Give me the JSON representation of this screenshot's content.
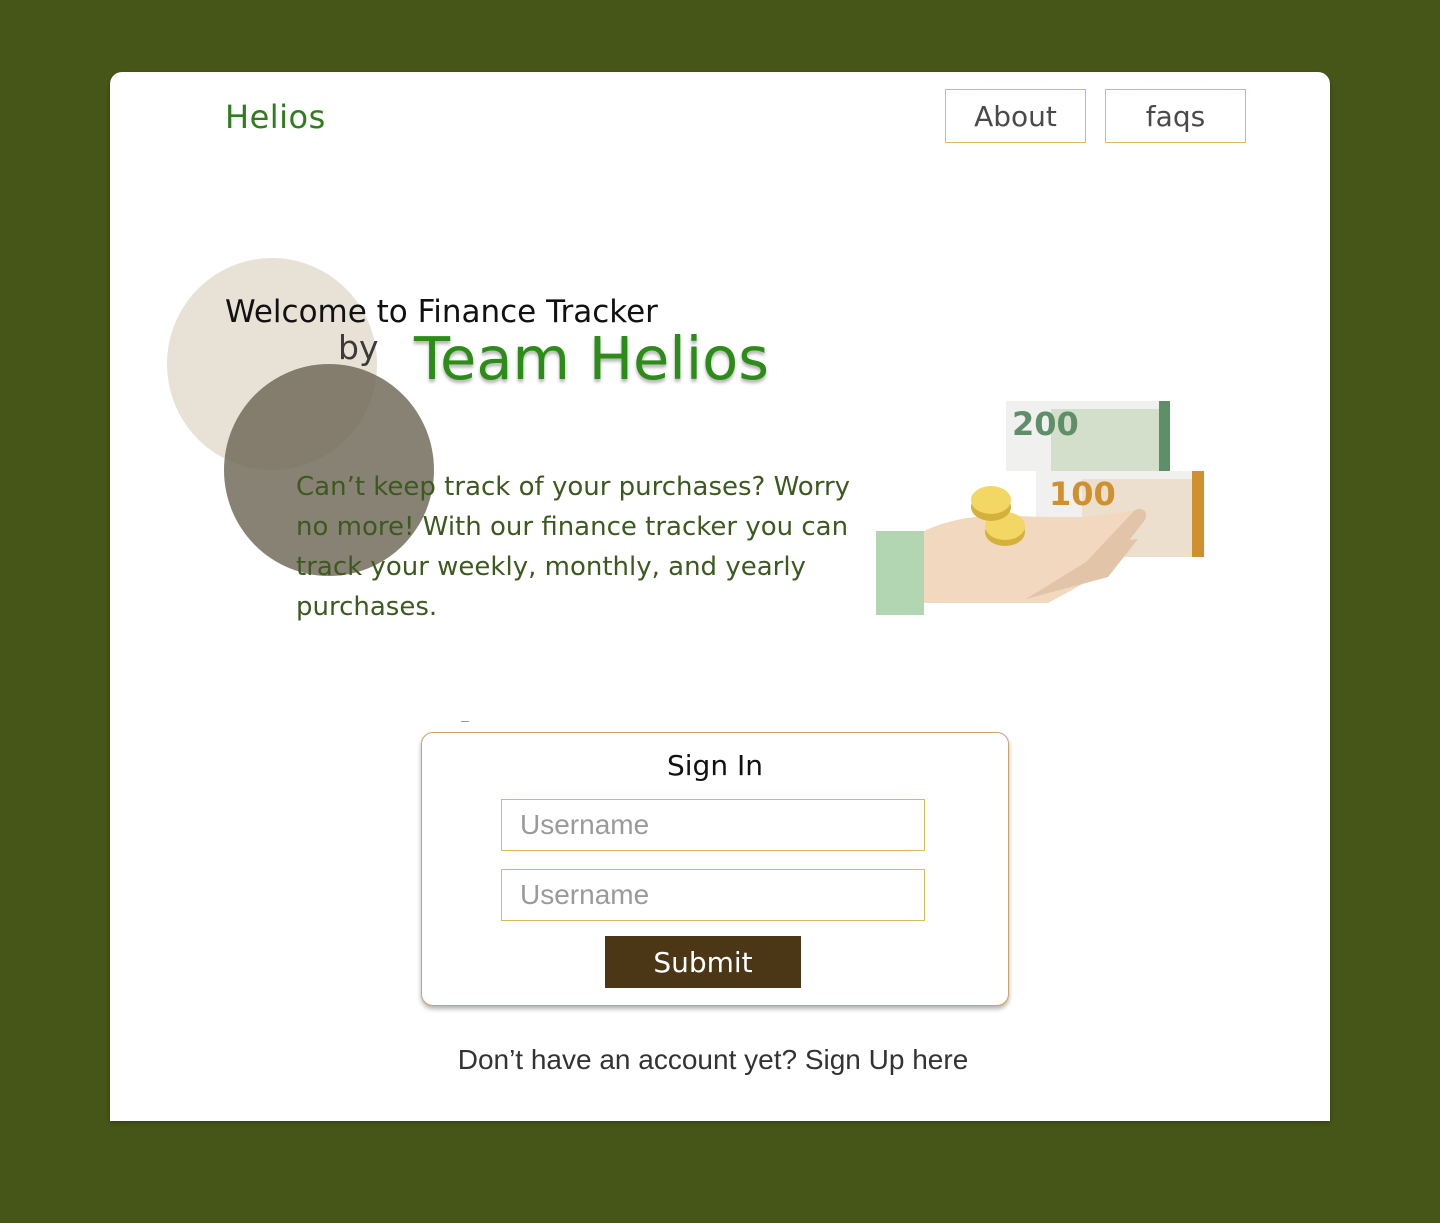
{
  "header": {
    "brand": "Helios",
    "nav": {
      "about": "About",
      "faqs": "faqs"
    }
  },
  "hero": {
    "welcome": "Welcome to Finance Tracker",
    "by": "by",
    "team": "Team Helios",
    "description": "Can’t keep track of your purchases? Worry no more! With our finance tracker you can track your weekly, monthly, and yearly purchases.",
    "illustration": {
      "note_top": "200",
      "note_bottom": "100"
    }
  },
  "signin": {
    "title": "Sign In",
    "username_placeholder": "Username",
    "password_placeholder": "Username",
    "submit_label": "Submit"
  },
  "footer": {
    "signup_text": "Don’t have an account yet? Sign Up here"
  },
  "colors": {
    "background": "#465619",
    "brand_green": "#2f7d1c",
    "accent_gold": "#d9bc5c",
    "button_brown": "#4b3716"
  }
}
